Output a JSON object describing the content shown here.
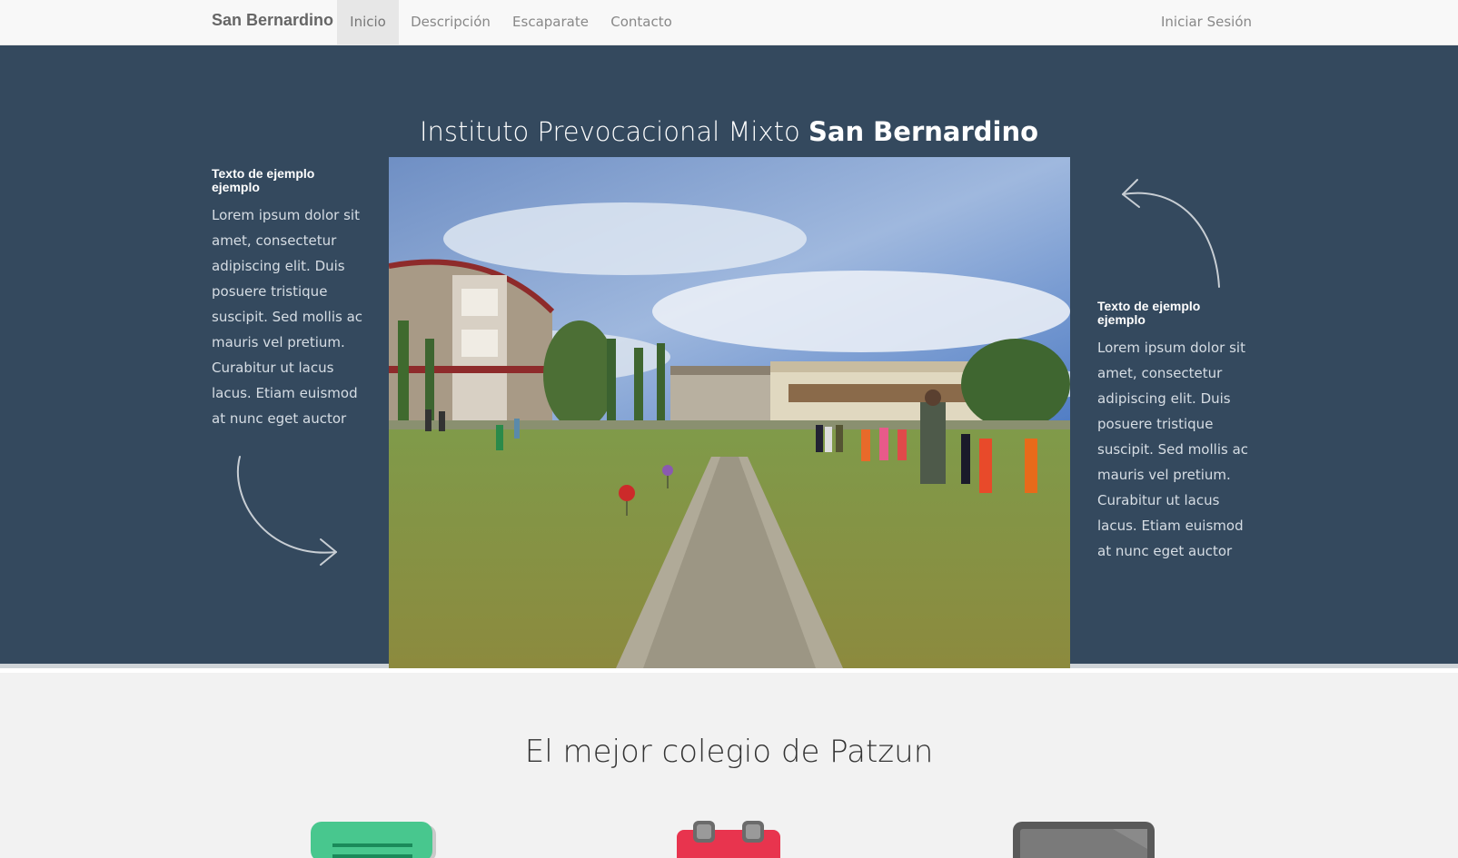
{
  "navbar": {
    "brand": "San Bernardino",
    "items": [
      {
        "label": "Inicio",
        "active": true
      },
      {
        "label": "Descripción",
        "active": false
      },
      {
        "label": "Escaparate",
        "active": false
      },
      {
        "label": "Contacto",
        "active": false
      }
    ],
    "login": "Iniciar Sesión"
  },
  "hero": {
    "title_prefix": "Instituto Prevocacional Mixto ",
    "title_strong": "San Bernardino",
    "left": {
      "heading": "Texto de ejemplo ejemplo",
      "text": "Lorem ipsum dolor sit amet, consectetur adipiscing elit. Duis posuere tristique suscipit. Sed mollis ac mauris vel pretium. Curabitur ut lacus lacus. Etiam euismod at nunc eget auctor"
    },
    "right": {
      "heading": "Texto de ejemplo ejemplo",
      "text": "Lorem ipsum dolor sit amet, consectetur adipiscing elit. Duis posuere tristique suscipit. Sed mollis ac mauris vel pretium. Curabitur ut lacus lacus. Etiam euismod at nunc eget auctor"
    }
  },
  "section": {
    "title": "El mejor colegio de Patzun",
    "icons": [
      "document-icon",
      "calendar-icon",
      "tablet-icon"
    ]
  },
  "colors": {
    "navbar_bg": "#f8f8f8",
    "hero_bg": "#34495e",
    "section_bg": "#f2f2f2",
    "green": "#48c78e",
    "red": "#e8344e",
    "gray": "#6b6b6b"
  }
}
